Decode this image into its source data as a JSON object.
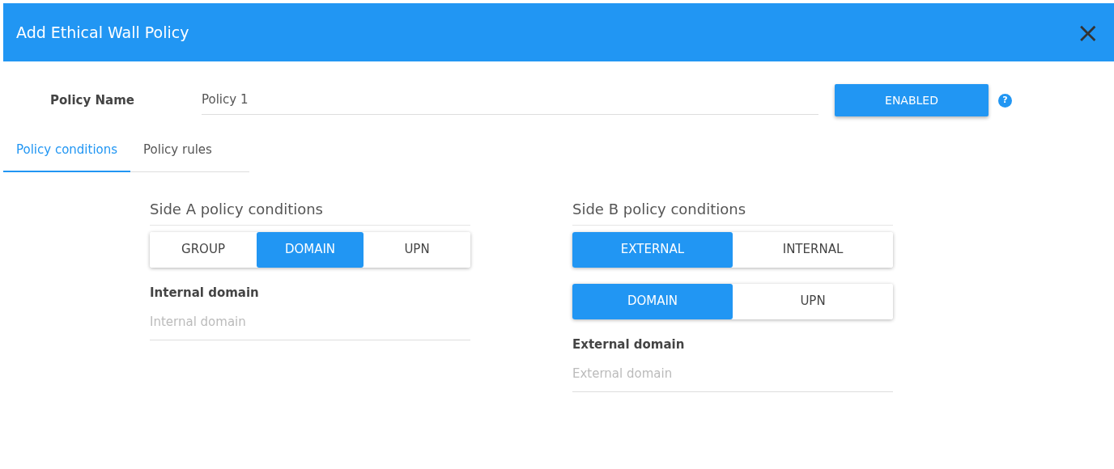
{
  "dialog": {
    "title": "Add Ethical Wall Policy",
    "close": "×"
  },
  "policy_name": {
    "label": "Policy Name",
    "value": "Policy 1",
    "status_button": "ENABLED",
    "help": "?"
  },
  "tabs": [
    {
      "label": "Policy conditions",
      "selected": true
    },
    {
      "label": "Policy rules",
      "selected": false
    }
  ],
  "sides": [
    {
      "title": "Side A policy conditions",
      "toggle_groups": [
        [
          {
            "label": "GROUP",
            "selected": false
          },
          {
            "label": "DOMAIN",
            "selected": true
          },
          {
            "label": "UPN",
            "selected": false
          }
        ]
      ],
      "field_label": "Internal domain",
      "placeholder": "Internal domain"
    },
    {
      "title": "Side B policy conditions",
      "toggle_groups": [
        [
          {
            "label": "EXTERNAL",
            "selected": true
          },
          {
            "label": "INTERNAL",
            "selected": false
          }
        ],
        [
          {
            "label": "DOMAIN",
            "selected": true
          },
          {
            "label": "UPN",
            "selected": false
          }
        ]
      ],
      "field_label": "External domain",
      "placeholder": "External domain"
    }
  ]
}
